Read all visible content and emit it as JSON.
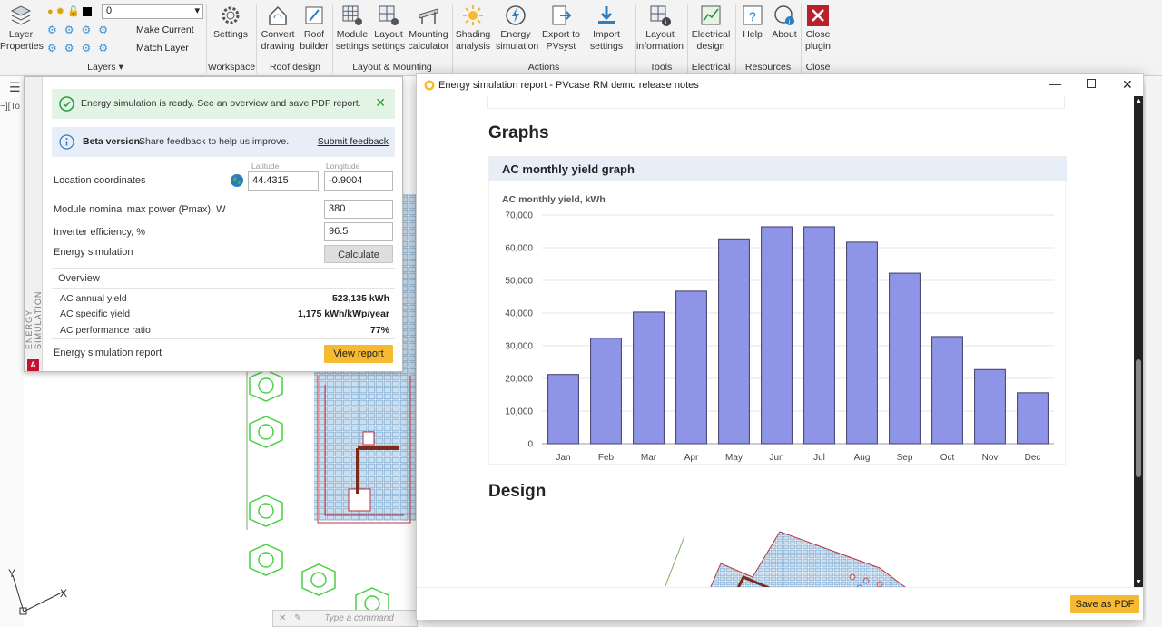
{
  "ribbon": {
    "layer_name": "0",
    "layer_properties": "Layer\nProperties",
    "make_current": "Make Current",
    "match_layer": "Match Layer",
    "groups": {
      "layers": "Layers ▾",
      "workspace": "Workspace",
      "roof": "Roof design",
      "layout": "Layout & Mounting",
      "actions": "Actions",
      "tools": "Tools",
      "electrical": "Electrical",
      "resources": "Resources",
      "close": "Close"
    },
    "buttons": {
      "settings": "Settings",
      "convert": "Convert\ndrawing",
      "roof_builder": "Roof\nbuilder",
      "module": "Module\nsettings",
      "layout": "Layout\nsettings",
      "mounting": "Mounting\ncalculator",
      "shading": "Shading\nanalysis",
      "energy": "Energy\nsimulation",
      "export": "Export to\nPVsyst",
      "import": "Import\nsettings",
      "layout_info": "Layout\ninformation",
      "electrical": "Electrical\ndesign",
      "help": "Help",
      "about": "About",
      "close": "Close\nplugin"
    }
  },
  "cad": {
    "view_label": "−][To",
    "command_placeholder": "Type a command"
  },
  "panel": {
    "side_title": "ENERGY SIMULATION",
    "success_msg": "Energy simulation is ready. See an overview and save PDF report.",
    "beta_bold": "Beta version.",
    "beta_msg": "Share feedback to help us improve.",
    "beta_link": "Submit feedback",
    "location_label": "Location coordinates",
    "lat_caption": "Latitude",
    "lon_caption": "Longitude",
    "lat_value": "44.4315",
    "lon_value": "-0.9004",
    "pmax_label": "Module nominal max power (Pmax), W",
    "pmax_value": "380",
    "inverter_label": "Inverter efficiency, %",
    "inverter_value": "96.5",
    "energy_label": "Energy simulation",
    "calculate": "Calculate",
    "overview_title": "Overview",
    "annual_label": "AC annual yield",
    "annual_value": "523,135 kWh",
    "specific_label": "AC specific yield",
    "specific_value": "1,175 kWh/kWp/year",
    "ratio_label": "AC performance ratio",
    "ratio_value": "77%",
    "report_label": "Energy simulation report",
    "view_report": "View report"
  },
  "report_window": {
    "title": "Energy simulation report - PVcase RM demo release notes",
    "graphs_heading": "Graphs",
    "graph_card_title": "AC monthly yield graph",
    "design_heading": "Design",
    "save_pdf": "Save as PDF"
  },
  "chart_data": {
    "type": "bar",
    "title": "AC monthly yield, kWh",
    "categories": [
      "Jan",
      "Feb",
      "Mar",
      "Apr",
      "May",
      "Jun",
      "Jul",
      "Aug",
      "Sep",
      "Oct",
      "Nov",
      "Dec"
    ],
    "values": [
      21200,
      32300,
      40300,
      46700,
      62700,
      66400,
      66400,
      61700,
      52200,
      32800,
      22700,
      15600
    ],
    "ylim": [
      0,
      70000
    ],
    "yticks": [
      "0",
      "10,000",
      "20,000",
      "30,000",
      "40,000",
      "50,000",
      "60,000",
      "70,000"
    ],
    "bar_color": "#8f95e6",
    "grid": true
  },
  "colors": {
    "accent": "#f5b932",
    "success_bg": "#e2f4e4",
    "info_bg": "#e7eef8",
    "close_red": "#b8202c"
  }
}
